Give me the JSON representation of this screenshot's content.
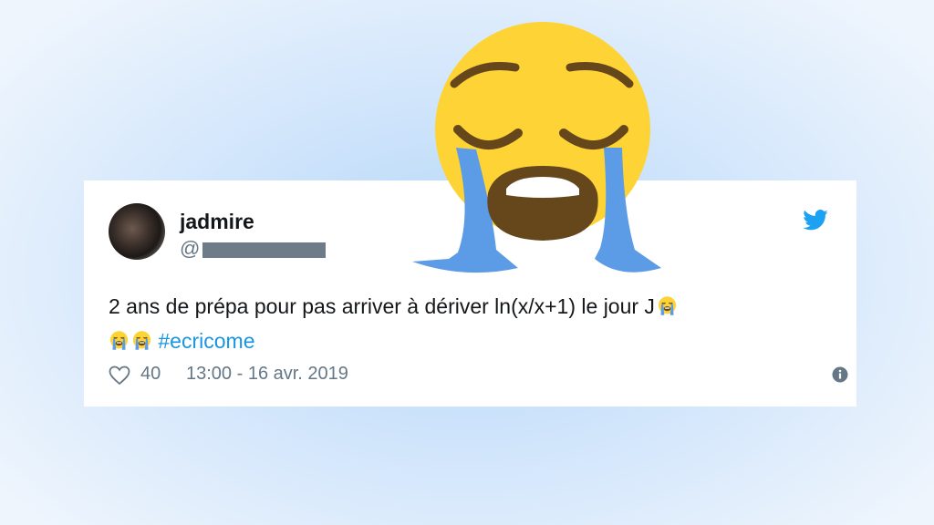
{
  "tweet": {
    "display_name": "jadmire",
    "handle_prefix": "@",
    "text": "2 ans de prépa pour pas arriver à  dériver ln(x/x+1) le jour J",
    "hashtag": "#ecricome",
    "like_count": "40",
    "timestamp": "13:00 - 16 avr. 2019"
  },
  "icons": {
    "brand": "twitter-bird-icon",
    "like": "heart-icon",
    "info": "info-icon",
    "emoji": "loudly-crying-face-icon"
  },
  "colors": {
    "hashtag": "#1b95e0",
    "twitter_blue": "#1da1f2",
    "secondary_text": "#657786",
    "emoji_face": "#fdd335",
    "emoji_tears": "#5c9ce6"
  }
}
